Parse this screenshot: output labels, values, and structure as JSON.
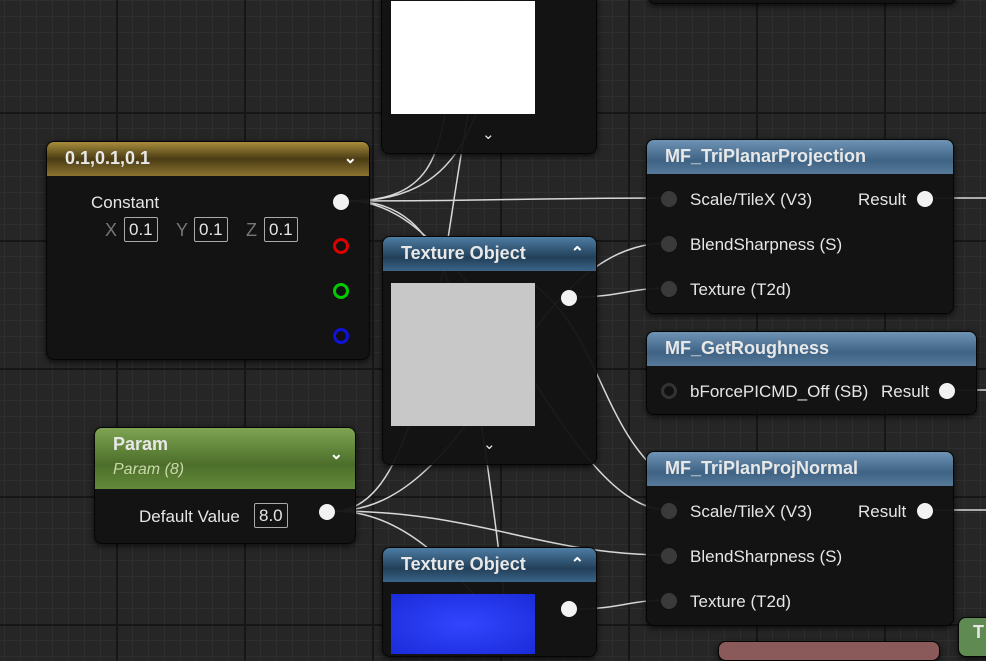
{
  "top_node": {
    "preview_color": "#ffffff"
  },
  "constant_node": {
    "title": "0.1,0.1,0.1",
    "label": "Constant",
    "x_label": "X",
    "x": "0.1",
    "y_label": "Y",
    "y": "0.1",
    "z_label": "Z",
    "z": "0.1"
  },
  "texture_object_1": {
    "title": "Texture Object",
    "preview_color": "#c8c8c8"
  },
  "texture_object_2": {
    "title": "Texture Object",
    "preview_color": "#1a2bd8"
  },
  "param_node": {
    "title": "Param",
    "subtitle": "Param (8)",
    "label": "Default Value",
    "value": "8.0"
  },
  "triplanar": {
    "title": "MF_TriPlanarProjection",
    "inputs": [
      "Scale/TileX (V3)",
      "BlendSharpness (S)",
      "Texture (T2d)"
    ],
    "output": "Result"
  },
  "roughness": {
    "title": "MF_GetRoughness",
    "inputs": [
      "bForcePICMD_Off (SB)"
    ],
    "output": "Result"
  },
  "triplan_normal": {
    "title": "MF_TriPlanProjNormal",
    "inputs": [
      "Scale/TileX (V3)",
      "BlendSharpness (S)",
      "Texture (T2d)"
    ],
    "output": "Result"
  },
  "partial_node": {
    "title": "T"
  }
}
